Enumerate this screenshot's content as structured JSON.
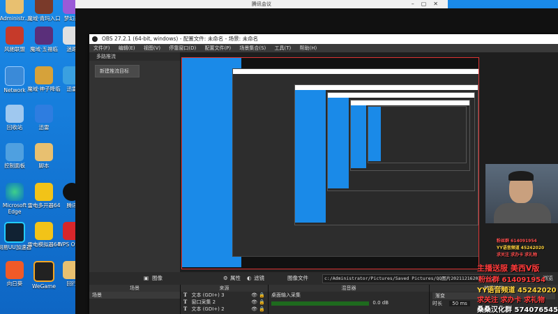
{
  "desktop": {
    "icons_col1": [
      "Administr...",
      "风驰联盟",
      "Network",
      "回收站",
      "控制面板",
      "Microsoft Edge",
      "网易UU加速器",
      "向日葵"
    ],
    "icons_col2": [
      "魔域·青玛入口",
      "魔域·五福临",
      "魔域·神子降临",
      "迅雷",
      "脚本",
      "雷电多开器64",
      "雷电模拟器64",
      "WeGame"
    ],
    "icons_col3": [
      "梦幻西",
      "迷路",
      "迅雷",
      "腾讯",
      "WPS Office",
      "回行"
    ]
  },
  "meeting_window": {
    "title": "腾讯会议"
  },
  "obs": {
    "title": "OBS 27.2.1 (64-bit, windows) - 配置文件: 未命名 - 场景: 未命名",
    "menu": [
      "文件(F)",
      "编辑(E)",
      "视图(V)",
      "停靠窗口(D)",
      "配置文件(P)",
      "场景集合(S)",
      "工具(T)",
      "帮助(H)"
    ],
    "left_dock_title": "多路推流",
    "add_target_label": "新建推流目标",
    "scene_bar": {
      "image_label": "图像",
      "properties_label": "属性",
      "filters_label": "滤镜",
      "image_file_label": "图像文件",
      "image_file_value": "c:/Administrator/Pictures/Saved Pictures/QQ图片20211216203258.png",
      "browse_label": "浏览"
    },
    "docks": {
      "scenes": {
        "title": "场景",
        "items": [
          "场景"
        ]
      },
      "sources": {
        "title": "来源",
        "items": [
          {
            "type": "T",
            "name": "文本 (GDI+) 3"
          },
          {
            "type": "T",
            "name": "窗口采集 2"
          },
          {
            "type": "T",
            "name": "文本 (GDI+) 2"
          }
        ]
      },
      "mixer": {
        "title": "混音器",
        "channel": "桌面输入采集",
        "db": "0.0 dB"
      },
      "transitions": {
        "title": "转场特效",
        "mode": "渐变",
        "duration_label": "时长",
        "duration_value": "50 ms"
      }
    }
  },
  "overlay": {
    "line1": "主播送服 美西V版",
    "line2": "粉丝群 614091954",
    "line3": "YY语音频道 45242020",
    "line4": "求关注 求办卡 求礼物",
    "line5": "桑桑汉化群 574076545",
    "small1": "粉丝群 614091954",
    "small2": "YY语音频道 45242020",
    "small3": "求关注 求办卡 求礼物"
  },
  "colors": {
    "obs_bg": "#2b2b2b",
    "desktop_blue": "#1a8ae8",
    "overlay_red": "#ff3b3b",
    "overlay_yellow": "#ffd23b"
  }
}
